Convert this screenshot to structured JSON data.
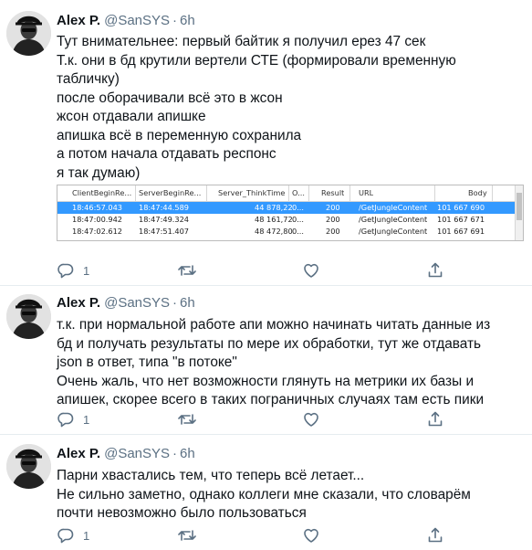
{
  "tweets": [
    {
      "author_name": "Alex P.",
      "handle": "@SanSYS",
      "separator": "·",
      "time": "6h",
      "lines": [
        "Тут внимательнее: первый байтик я получил ерез 47 сек",
        "Т.к. они в бд крутили вертели СТЕ (формировали временную",
        "табличку)",
        "после оборачивали всё это в жсон",
        "жсон отдавали апишке",
        "апишка всё в переменную сохранила",
        "а потом начала отдавать респонс",
        "я так думаю)"
      ],
      "reply_count": "1",
      "retweet_count": "",
      "like_count": "",
      "attachment_table": {
        "columns": [
          "ClientBeginRe...",
          "ServerBeginRe...",
          "Server_ThinkTime",
          "O...",
          "Result",
          "URL",
          "Body"
        ],
        "rows": [
          [
            "18:46:57.043",
            "18:47:44.589",
            "44 878,22",
            "0...",
            "200",
            "/GetJungleContent",
            "101 667 690"
          ],
          [
            "18:47:00.942",
            "18:47:49.324",
            "48 161,72",
            "0...",
            "200",
            "/GetJungleContent",
            "101 667 671"
          ],
          [
            "18:47:02.612",
            "18:47:51.407",
            "48 472,80",
            "0...",
            "200",
            "/GetJungleContent",
            "101 667 691"
          ]
        ],
        "selected_row": 0,
        "selected_color": "#3399ff"
      }
    },
    {
      "author_name": "Alex P.",
      "handle": "@SanSYS",
      "separator": "·",
      "time": "6h",
      "lines": [
        "т.к. при нормальной работе апи можно начинать читать данные из",
        "бд и получать результаты по мере их обработки, тут же отдавать",
        "json в ответ, типа \"в потоке\"",
        "Очень жаль, что нет возможности глянуть на метрики их базы и",
        "апишек, скорее всего в таких пограничных случаях там есть пики"
      ],
      "reply_count": "1",
      "retweet_count": "",
      "like_count": ""
    },
    {
      "author_name": "Alex P.",
      "handle": "@SanSYS",
      "separator": "·",
      "time": "6h",
      "lines": [
        "Парни хвастались тем, что теперь всё летает...",
        "Не сильно заметно, однако коллеги мне сказали, что словарём",
        "почти невозможно было пользоваться"
      ],
      "reply_count": "1",
      "retweet_count": "",
      "like_count": ""
    }
  ],
  "icons": {
    "reply": "reply-icon",
    "retweet": "retweet-icon",
    "like": "heart-icon",
    "share": "share-icon"
  },
  "colors": {
    "text": "#0f1419",
    "secondary": "#5b7083",
    "divider": "#e6ecf0"
  }
}
